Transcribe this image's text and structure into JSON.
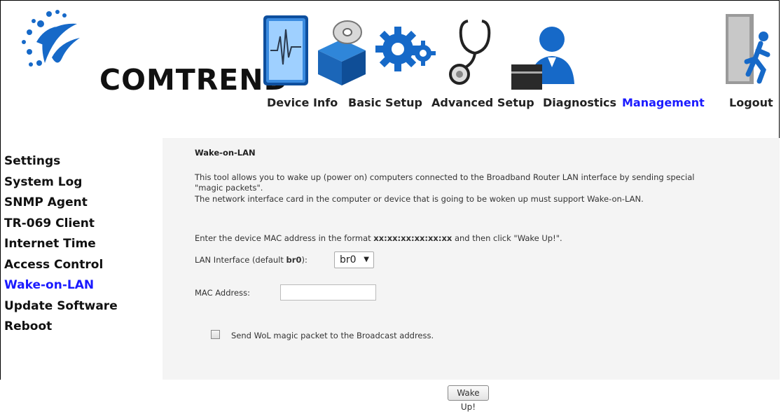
{
  "brand": {
    "name": "COMTREND"
  },
  "nav": {
    "items": [
      {
        "label": "Device Info",
        "icon": "monitor-chart-icon"
      },
      {
        "label": "Basic Setup",
        "icon": "disc-box-icon"
      },
      {
        "label": "Advanced Setup",
        "icon": "gears-icon"
      },
      {
        "label": "Diagnostics",
        "icon": "stethoscope-icon"
      },
      {
        "label": "Management",
        "icon": "person-card-icon",
        "active": true
      },
      {
        "label": "Logout",
        "icon": "exit-door-icon"
      }
    ]
  },
  "sidebar": {
    "items": [
      {
        "label": "Settings"
      },
      {
        "label": "System Log"
      },
      {
        "label": "SNMP Agent"
      },
      {
        "label": "TR-069 Client"
      },
      {
        "label": "Internet Time"
      },
      {
        "label": "Access Control"
      },
      {
        "label": "Wake-on-LAN",
        "active": true
      },
      {
        "label": "Update Software"
      },
      {
        "label": "Reboot"
      }
    ]
  },
  "main": {
    "title": "Wake-on-LAN",
    "desc_line1": "This tool allows you to wake up (power on) computers connected to the Broadband Router LAN interface by sending special",
    "desc_line2": "\"magic packets\".",
    "desc_line3": "The network interface card in the computer or device that is going to be woken up must support Wake-on-LAN.",
    "format_prefix": "Enter the device MAC address in the format ",
    "format_value": "xx:xx:xx:xx:xx:xx",
    "format_suffix": " and then click \"Wake Up!\".",
    "lan_label_prefix": "LAN Interface (default ",
    "lan_label_default": "br0",
    "lan_label_suffix": "):",
    "lan_selected": "br0",
    "mac_label": "MAC Address:",
    "mac_value": "",
    "broadcast_label": "Send WoL magic packet to the Broadcast address.",
    "broadcast_checked": false,
    "wake_button": "Wake Up!"
  },
  "colors": {
    "accent": "#1a1aff",
    "logo_blue": "#1669c8",
    "content_bg": "#f4f4f4"
  }
}
